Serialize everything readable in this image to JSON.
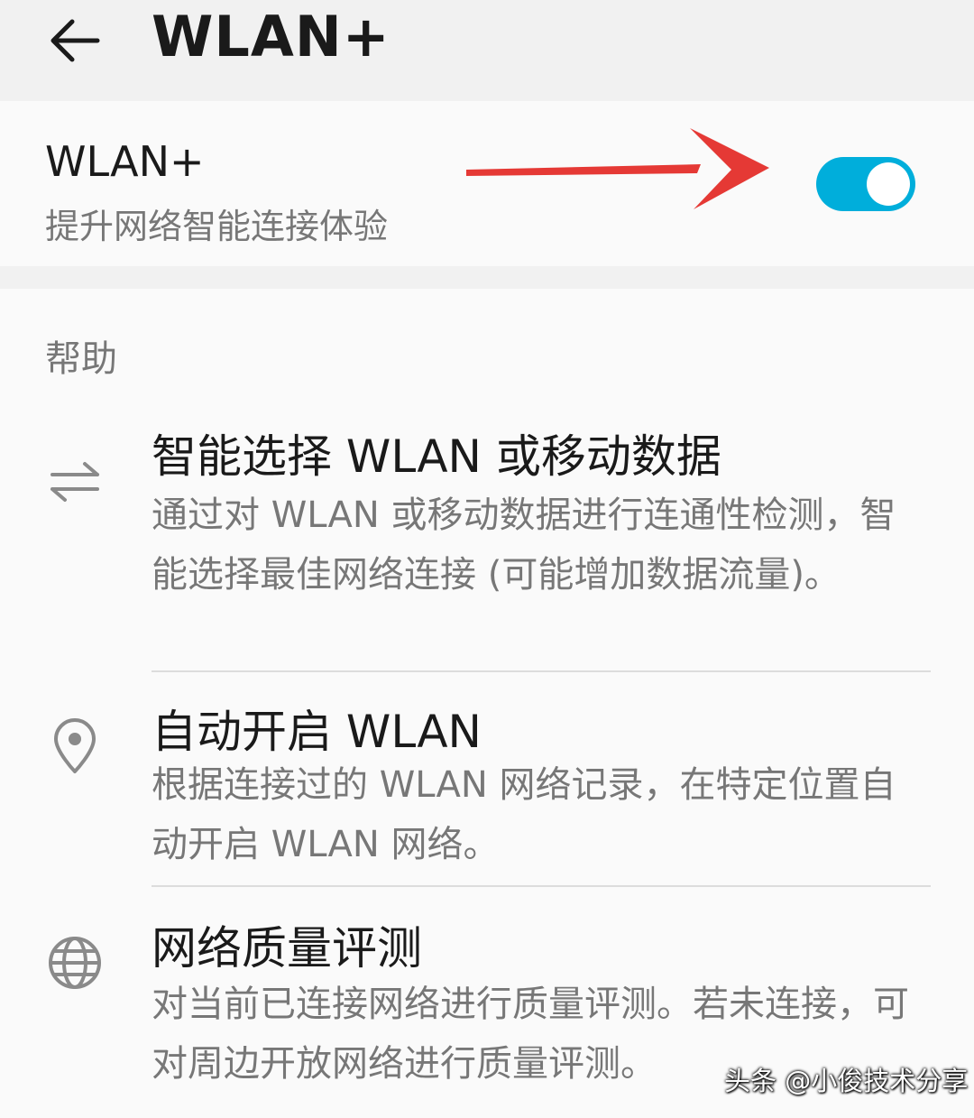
{
  "header": {
    "title": "WLAN+",
    "back_icon": "back-arrow-icon"
  },
  "wlan_plus": {
    "title": "WLAN+",
    "subtitle": "提升网络智能连接体验",
    "toggle_on": true,
    "accent": "#00aedb",
    "annotation_color": "#e53935"
  },
  "help": {
    "heading": "帮助",
    "items": [
      {
        "icon": "swap-arrows-icon",
        "title": "智能选择 WLAN 或移动数据",
        "desc": "通过对 WLAN 或移动数据进行连通性检测，智能选择最佳网络连接 (可能增加数据流量)。"
      },
      {
        "icon": "location-pin-icon",
        "title": "自动开启 WLAN",
        "desc": "根据连接过的 WLAN 网络记录，在特定位置自动开启 WLAN 网络。"
      },
      {
        "icon": "globe-icon",
        "title": "网络质量评测",
        "desc": "对当前已连接网络进行质量评测。若未连接，可对周边开放网络进行质量评测。"
      }
    ]
  },
  "watermark": "头条 @小俊技术分享"
}
